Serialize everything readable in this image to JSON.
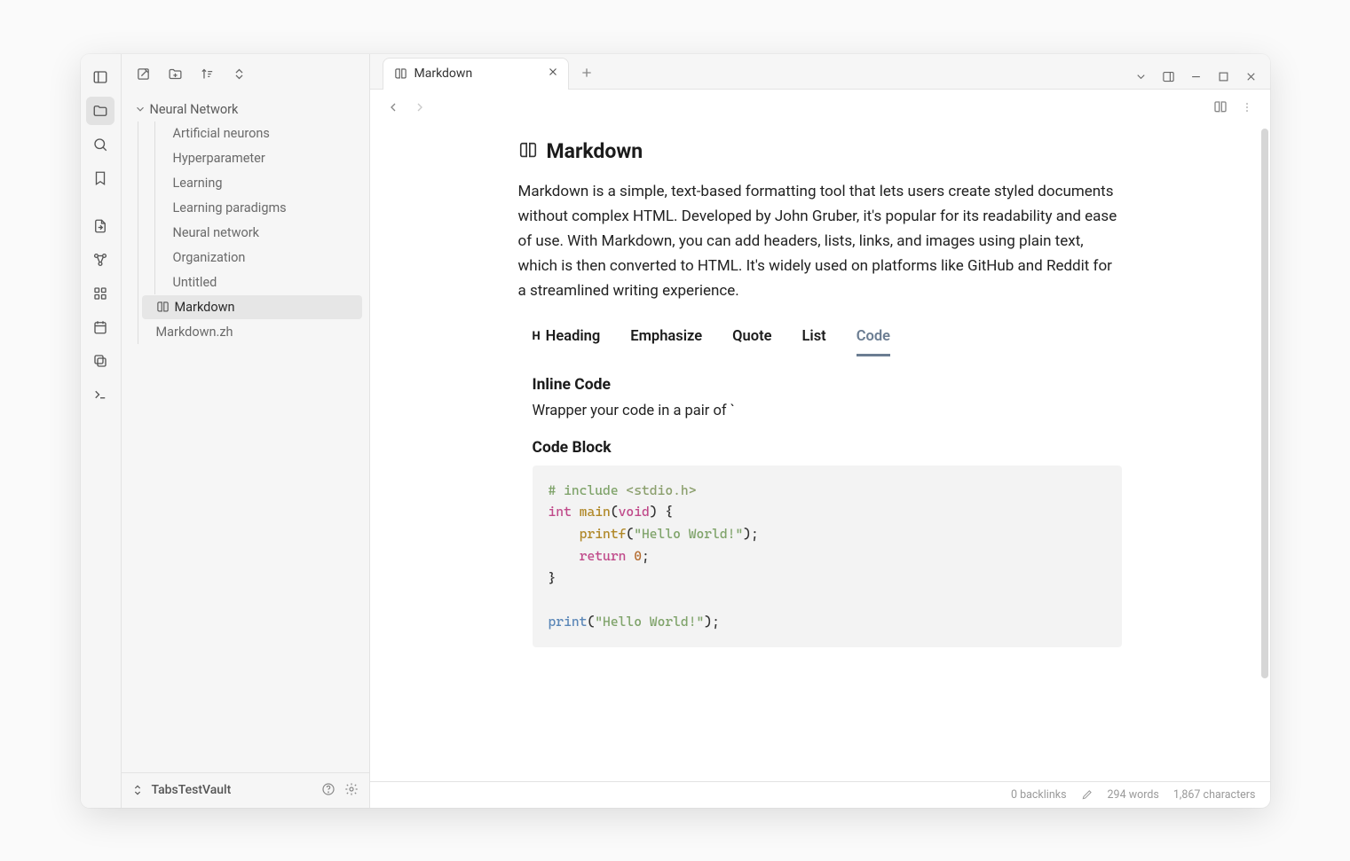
{
  "ribbon": {
    "items": [
      "panel-left",
      "folder",
      "search",
      "bookmark",
      "file-plus",
      "graph",
      "grid",
      "calendar",
      "copy",
      "terminal"
    ],
    "active_index": 1
  },
  "side_actions": [
    "edit-icon",
    "new-folder-icon",
    "sort-icon",
    "collapse-icon"
  ],
  "tree": {
    "folder_label": "Neural Network",
    "children": [
      {
        "label": "Artificial neurons"
      },
      {
        "label": "Hyperparameter"
      },
      {
        "label": "Learning"
      },
      {
        "label": "Learning paradigms"
      },
      {
        "label": "Neural network"
      },
      {
        "label": "Organization"
      },
      {
        "label": "Untitled"
      }
    ],
    "files": [
      {
        "label": "Markdown",
        "icon": "book",
        "selected": true
      },
      {
        "label": "Markdown.zh"
      }
    ]
  },
  "vault_name": "TabsTestVault",
  "tab": {
    "label": "Markdown"
  },
  "doc": {
    "title": "Markdown",
    "intro": "Markdown is a simple, text-based formatting tool that lets users create styled documents without complex HTML. Developed by John Gruber, it's popular for its readability and ease of use. With Markdown, you can add headers, lists, links, and images using plain text, which is then converted to HTML. It's widely used on platforms like GitHub and Reddit for a streamlined writing experience.",
    "tabs": [
      {
        "label": "Heading",
        "prefix": "H"
      },
      {
        "label": "Emphasize"
      },
      {
        "label": "Quote"
      },
      {
        "label": "List"
      },
      {
        "label": "Code",
        "active": true
      }
    ],
    "inline_code_h": "Inline Code",
    "inline_code_p": "Wrapper your code in a pair of `",
    "code_block_h": "Code Block",
    "code": {
      "l1a": "# include",
      "l1b": " <stdio.h>",
      "l2a": "int",
      "l2b": " main",
      "l2c": "(",
      "l2d": "void",
      "l2e": ") {",
      "l3a": "    printf",
      "l3b": "(",
      "l3c": "\"Hello World!\"",
      "l3d": ");",
      "l4a": "    return ",
      "l4b": "0",
      "l4c": ";",
      "l5": "}",
      "l6": "",
      "l7a": "print",
      "l7b": "(",
      "l7c": "\"Hello World!\"",
      "l7d": ");"
    }
  },
  "status": {
    "backlinks": "0 backlinks",
    "words": "294 words",
    "chars": "1,867 characters"
  }
}
